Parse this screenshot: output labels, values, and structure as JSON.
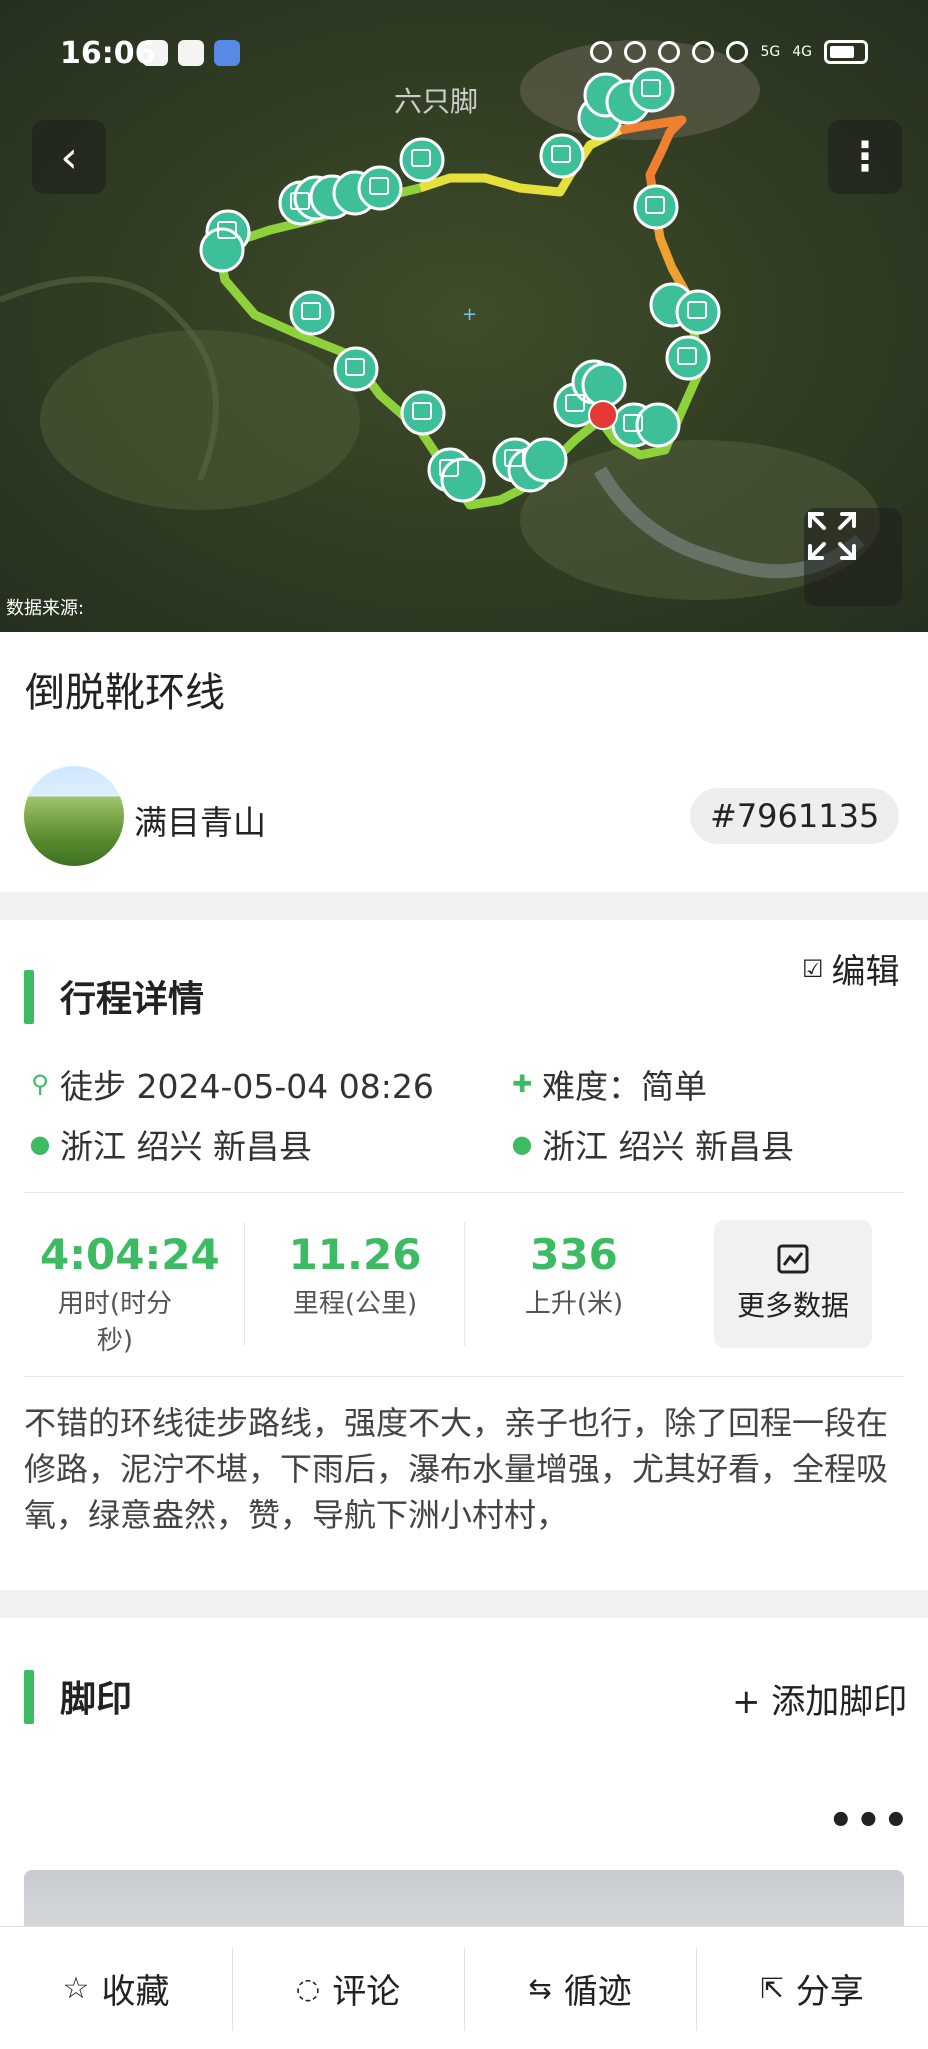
{
  "status_bar": {
    "time": "16:06",
    "signal_5g": "5G",
    "signal_4g": "4G"
  },
  "map": {
    "watermark": "六只脚",
    "data_source": "数据来源:"
  },
  "trail": {
    "title": "倒脱靴环线",
    "author": "满目青山",
    "id": "#7961135"
  },
  "details": {
    "section_title": "行程详情",
    "edit_label": "编辑",
    "activity": "徒步 2024-05-04 08:26",
    "difficulty": "难度：简单",
    "start": "浙江 绍兴 新昌县",
    "end": "浙江 绍兴 新昌县",
    "stats": [
      {
        "value": "4:04:24",
        "label": "用时(时分秒)"
      },
      {
        "value": "11.26",
        "label": "里程(公里)"
      },
      {
        "value": "336",
        "label": "上升(米)"
      }
    ],
    "more_data": "更多数据",
    "description": "不错的环线徒步路线，强度不大，亲子也行，除了回程一段在修路，泥泞不堪，下雨后，瀑布水量增强，尤其好看，全程吸氧，绿意盎然，赞，导航下洲小村村，"
  },
  "footprints": {
    "section_title": "脚印",
    "add_label": "+ 添加脚印"
  },
  "bottom_bar": {
    "favorite": "收藏",
    "comment": "评论",
    "follow_track": "循迹",
    "share": "分享"
  },
  "colors": {
    "accent": "#3dbb63",
    "route_green": "#8fd13a",
    "route_yellow": "#e6e03a",
    "route_orange": "#f0a030",
    "pin": "#3dbf9a"
  }
}
